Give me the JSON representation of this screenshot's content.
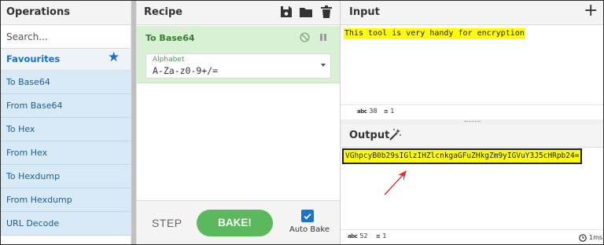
{
  "operations": {
    "title": "Operations",
    "search_placeholder": "Search...",
    "favourites_label": "Favourites",
    "items": [
      {
        "label": "To Base64"
      },
      {
        "label": "From Base64"
      },
      {
        "label": "To Hex"
      },
      {
        "label": "From Hex"
      },
      {
        "label": "To Hexdump"
      },
      {
        "label": "From Hexdump"
      },
      {
        "label": "URL Decode"
      }
    ]
  },
  "recipe": {
    "title": "Recipe",
    "toolbar_icons": [
      "save-icon",
      "folder-icon",
      "trash-icon"
    ],
    "operation": {
      "name": "To Base64",
      "arg_label": "Alphabet",
      "arg_value": "A-Za-z0-9+/="
    },
    "step_label": "STEP",
    "bake_label": "BAKE!",
    "autobake_label": "Auto Bake",
    "autobake_checked": true
  },
  "input": {
    "title": "Input",
    "text": "This tool is very handy for encryption",
    "length": "38",
    "lines": "1"
  },
  "output": {
    "title": "Output",
    "text": "VGhpcyB0b29sIGlzIHZlcnkgaGFuZHkgZm9yIGVuY3J5cHRpb24=",
    "length": "52",
    "lines": "1",
    "time": "1ms"
  },
  "colors": {
    "highlight": "#ffff00",
    "bake": "#5cb85c",
    "accent": "#1a72c9",
    "op_list_bg": "#d8eaf6",
    "recipe_card_bg": "#d8f0d4",
    "annotation_arrow": "#e03030"
  }
}
